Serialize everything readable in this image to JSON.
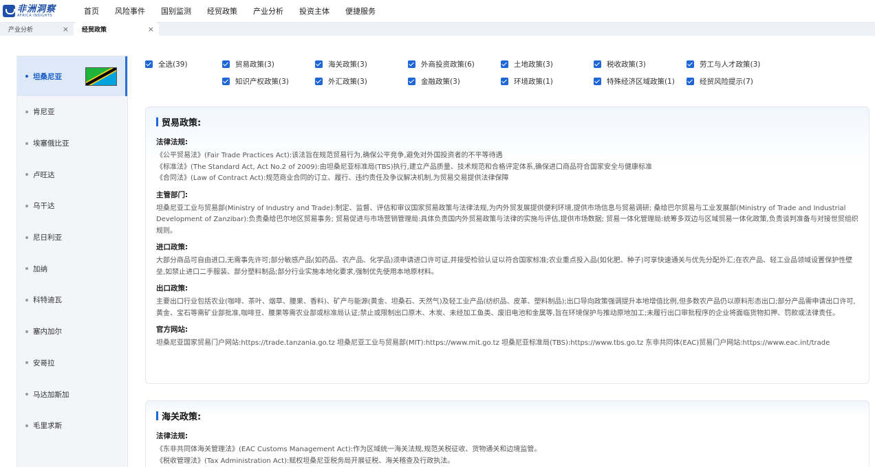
{
  "logo": {
    "cn": "非洲洞察",
    "en": "AFRICA INSIGHTS"
  },
  "nav": [
    "首页",
    "风险事件",
    "国别监测",
    "经贸政策",
    "产业分析",
    "投资主体",
    "便捷服务"
  ],
  "tabs": [
    {
      "label": "产业分析",
      "close": "×"
    },
    {
      "label": "经贸政策",
      "close": "×"
    }
  ],
  "countries": [
    "坦桑尼亚",
    "肯尼亚",
    "埃塞俄比亚",
    "卢旺达",
    "乌干达",
    "尼日利亚",
    "加纳",
    "科特迪瓦",
    "塞内加尔",
    "安哥拉",
    "马达加斯加",
    "毛里求斯"
  ],
  "filters": {
    "row1": [
      "全选(39)",
      "贸易政策(3)",
      "海关政策(3)",
      "外商投资政策(6)",
      "土地政策(3)",
      "税收政策(3)",
      "劳工与人才政策(3)"
    ],
    "row2": [
      "知识产权政策(3)",
      "外汇政策(3)",
      "金融政策(3)",
      "环境政策(1)",
      "特殊经济区域政策(1)",
      "经贸风险提示(7)"
    ]
  },
  "trade": {
    "title": "贸易政策:",
    "law_title": "法律法规:",
    "laws": [
      "《公平贸易法》(Fair Trade Practices Act):该法旨在规范贸易行为,确保公平竞争,避免对外国投资者的不平等待遇",
      "《标准法》(The Standard Act, Act No.2 of 2009):由坦桑尼亚标准局(TBS)执行,建立产品质量、技术规范和合格评定体系,确保进口商品符合国家安全与健康标准",
      "《合同法》(Law of Contract Act):规范商业合同的订立、履行、违约责任及争议解决机制,为贸易交易提供法律保障"
    ],
    "dept_title": "主管部门:",
    "dept_text": "坦桑尼亚工业与贸易部(Ministry of Industry and Trade):制定、监督、评估和审议国家贸易政策与法律法规,为内外贸发展提供便利环境,提供市场信息与贸易调研; 桑给巴尔贸易与工业发展部(Ministry of Trade and Industrial Development of Zanzibar):负责桑给巴尔地区贸易事务; 贸易促进与市场营销管理局:具体负责国内外贸易政策与法律的实施与评估,提供市场数据; 贸易一体化管理局:统筹多双边与区域贸易一体化政策,负责谈判准备与对接世贸组织规则。",
    "import_title": "进口政策:",
    "import_text": "大部分商品可自由进口,无需事先许可;部分敏感产品(如药品、农产品、化学品)须申请进口许可证,并接受检验认证以符合国家标准;农业重点投入品(如化肥、种子)可享快速通关与优先分配外汇;在农产品、轻工业品领域设置保护性壁垒,如禁止进口二手服装、部分塑料制品;部分行业实施本地化要求,强制优先使用本地原材料。",
    "export_title": "出口政策:",
    "export_text": "主要出口行业包括农业(咖啡、茶叶、烟草、腰果、香料)、矿产与能源(黄金、坦桑石、天然气)及轻工业产品(纺织品、皮革、塑料制品);出口导向政策强调提升本地增值比例,但多数农产品仍以原料形态出口;部分产品需申请出口许可,黄金、宝石等需矿业部批准,咖啡豆、腰果等需农业部或标准局认证;禁止或限制出口原木、木炭、未经加工鱼类、废旧电池和金属等,旨在环境保护与推动原地加工;未履行出口审批程序的企业将面临货物扣押、罚款或法律责任。",
    "site_title": "官方网站:",
    "site_text": "坦桑尼亚国家贸易门户网站:https://trade.tanzania.go.tz 坦桑尼亚工业与贸易部(MIT):https://www.mit.go.tz 坦桑尼亚标准局(TBS):https://www.tbs.go.tz 东非共同体(EAC)贸易门户网站:https://www.eac.int/trade"
  },
  "customs": {
    "title": "海关政策:",
    "law_title": "法律法规:",
    "laws": [
      "《东非共同体海关管理法》(EAC Customs Management Act):作为区域统一海关法规,规范关税征收、货物通关和边境监管。",
      "《税收管理法》(Tax Administration Act):赋权坦桑尼亚税务局开展征税、海关稽查及行政执法。"
    ]
  },
  "colors": {
    "accent": "#1f66d6",
    "flag_green": "#1eb53a",
    "flag_blue": "#00a3dd",
    "flag_yellow": "#fcd116"
  }
}
